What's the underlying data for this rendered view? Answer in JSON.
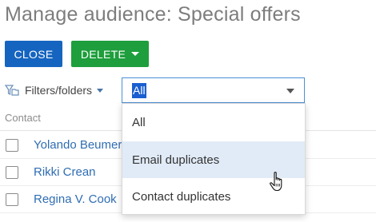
{
  "title": "Manage audience:  Special offers",
  "toolbar": {
    "close_label": "CLOSE",
    "delete_label": "DELETE"
  },
  "filters": {
    "label": "Filters/folders",
    "icon": "filter-folder-icon"
  },
  "select": {
    "value": "All",
    "options": [
      "All",
      "Email duplicates",
      "Contact duplicates"
    ],
    "highlighted_option": "Email duplicates"
  },
  "table": {
    "column_header": "Contact",
    "rows": [
      {
        "name": "Yolando Beumer"
      },
      {
        "name": "Rikki Crean"
      },
      {
        "name": "Regina V. Cook"
      }
    ]
  },
  "colors": {
    "close_button": "#1565c0",
    "delete_button": "#1e9e3c",
    "link": "#2f6db3",
    "highlight": "#e1ebf7"
  }
}
